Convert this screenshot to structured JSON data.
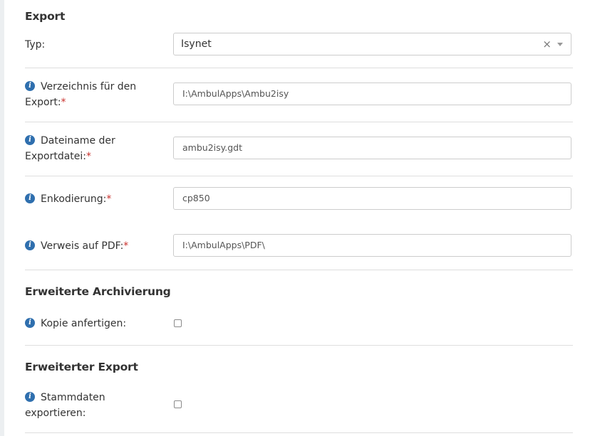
{
  "export": {
    "title": "Export",
    "typ": {
      "label": "Typ:",
      "value": "Isynet"
    },
    "verzeichnis": {
      "label_line1": "Verzeichnis für den",
      "label_line2": "Export:",
      "value": "I:\\AmbulApps\\Ambu2isy"
    },
    "dateiname": {
      "label_line1": "Dateiname der",
      "label_line2": "Exportdatei:",
      "value": "ambu2isy.gdt"
    },
    "enkodierung": {
      "label": "Enkodierung:",
      "value": "cp850"
    },
    "pdf": {
      "label": "Verweis auf PDF:",
      "value": "I:\\AmbulApps\\PDF\\"
    }
  },
  "archivierung": {
    "title": "Erweiterte Archivierung",
    "kopie": {
      "label": "Kopie anfertigen:",
      "checked": false
    }
  },
  "erweiterter_export": {
    "title": "Erweiterter Export",
    "stammdaten": {
      "label_line1": "Stammdaten",
      "label_line2": "exportieren:",
      "checked": false
    }
  },
  "required_marker": "*",
  "info_glyph": "i",
  "clear_glyph": "×",
  "icons": {
    "info": "info-circle-icon",
    "clear": "clear-icon",
    "caret": "chevron-down-icon"
  },
  "colors": {
    "info": "#2f6fae",
    "required": "#c9302c",
    "border": "#cccccc",
    "divider": "#dedede"
  }
}
